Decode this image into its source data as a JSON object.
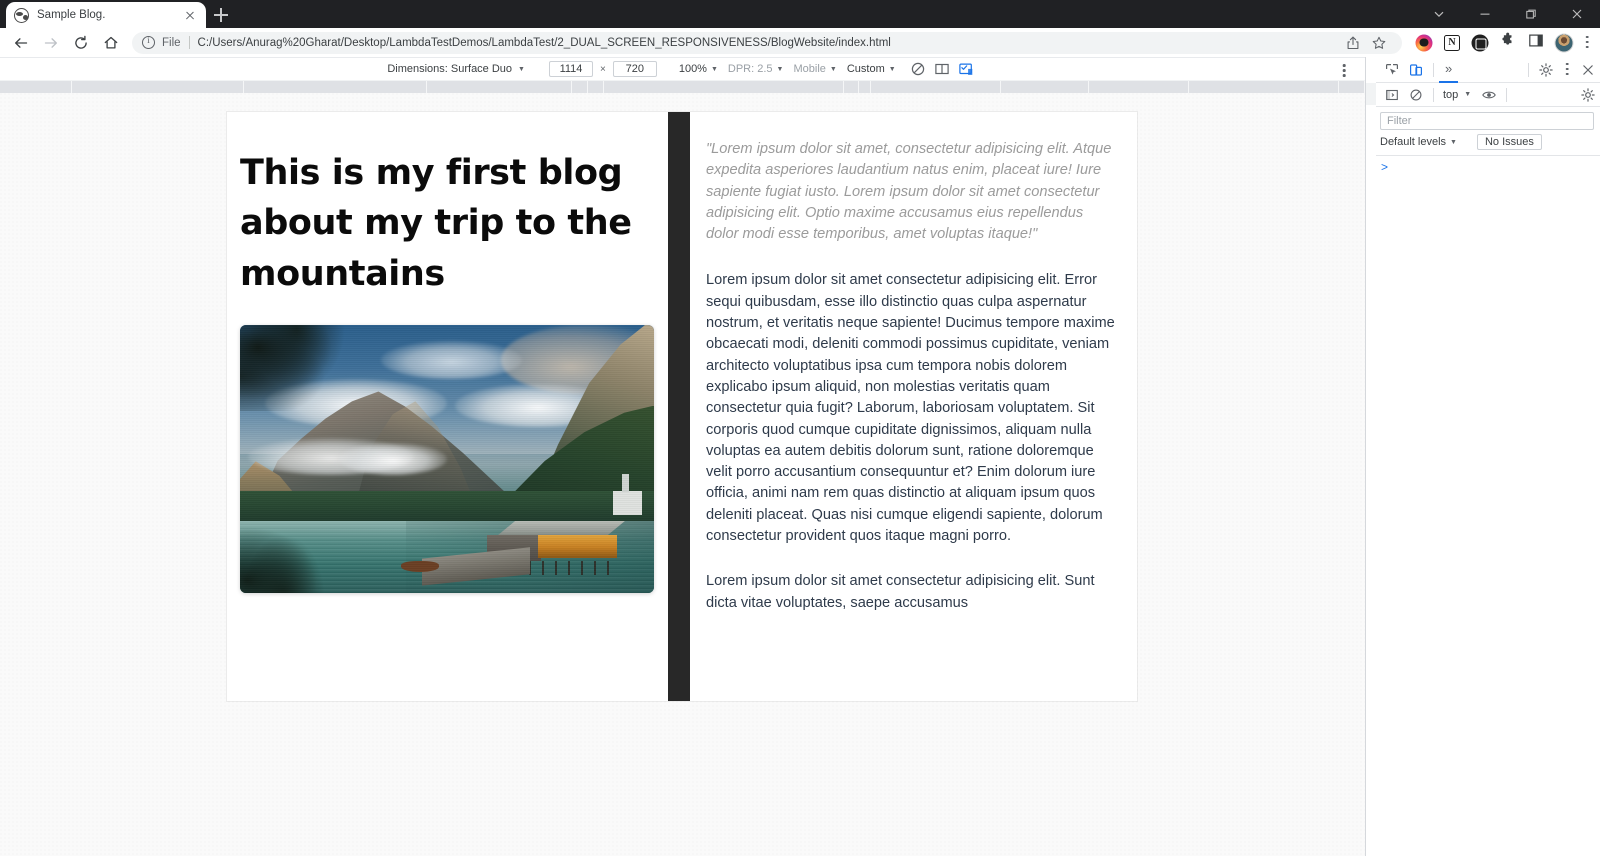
{
  "browser": {
    "tab": {
      "title": "Sample Blog.",
      "favicon": "globe-icon",
      "close": "close-icon"
    },
    "new_tab_label": "+",
    "window_controls": [
      "tab-search-chevron",
      "minimize",
      "restore",
      "close"
    ],
    "nav": {
      "back": "back-arrow",
      "forward": "forward-arrow",
      "reload": "reload-icon",
      "home": "home-icon"
    },
    "omnibox": {
      "info_icon": "info-circle-icon",
      "scheme_label": "File",
      "url": "C:/Users/Anurag%20Gharat/Desktop/LambdaTestDemos/LambdaTest/2_DUAL_SCREEN_RESPONSIVENESS/BlogWebsite/index.html",
      "share_icon": "share-icon",
      "bookmark_icon": "star-icon"
    },
    "extensions": [
      {
        "name": "instagram-extension-icon",
        "glyph": ""
      },
      {
        "name": "notion-extension-icon",
        "glyph": "N"
      },
      {
        "name": "dark-reader-extension-icon",
        "glyph": ""
      },
      {
        "name": "extensions-puzzle-icon",
        "glyph": ""
      },
      {
        "name": "side-panel-icon",
        "glyph": ""
      },
      {
        "name": "profile-avatar",
        "glyph": ""
      }
    ],
    "menu_icon": "kebab-menu-icon"
  },
  "device_toolbar": {
    "dimensions_label": "Dimensions: Surface Duo",
    "width": "1114",
    "separator": "×",
    "height": "720",
    "zoom": "100%",
    "dpr": "DPR: 2.5",
    "user_agent": "Mobile",
    "ua_custom": "Custom",
    "throttle_icon": "no-throttling-icon",
    "dual_screen_icon": "dual-screen-icon",
    "span_icon": "screen-span-icon",
    "kebab": "kebab-menu-icon"
  },
  "ruler": {
    "segments": [
      72,
      172,
      183,
      145,
      16,
      16,
      240,
      15,
      12,
      130,
      88,
      100,
      150,
      26
    ]
  },
  "page": {
    "title": "This is my first blog about my trip to the mountains",
    "image_alt": "mountain-lake-boathouse-photo",
    "blockquote": "\"Lorem ipsum dolor sit amet, consectetur adipisicing elit. Atque expedita asperiores laudantium natus enim, placeat iure! Iure sapiente fugiat iusto. Lorem ipsum dolor sit amet consectetur adipisicing elit. Optio maxime accusamus eius repellendus dolor modi esse temporibus, amet voluptas itaque!\"",
    "paragraphs": [
      "Lorem ipsum dolor sit amet consectetur adipisicing elit. Error sequi quibusdam, esse illo distinctio quas culpa aspernatur nostrum, et veritatis neque sapiente! Ducimus tempore maxime obcaecati modi, deleniti commodi possimus cupiditate, veniam architecto voluptatibus ipsa cum tempora nobis dolorem explicabo ipsum aliquid, non molestias veritatis quam consectetur quia fugit? Laborum, laboriosam voluptatem. Sit corporis quod cumque cupiditate dignissimos, aliquam nulla voluptas ea autem debitis dolorum sunt, ratione doloremque velit porro accusantium consequuntur et? Enim dolorum iure officia, animi nam rem quas distinctio at aliquam ipsum quos deleniti placeat. Quas nisi cumque eligendi sapiente, dolorum consectetur provident quos itaque magni porro.",
      "Lorem ipsum dolor sit amet consectetur adipisicing elit. Sunt dicta vitae voluptates, saepe accusamus"
    ]
  },
  "devtools": {
    "inspect_icon": "inspect-element-icon",
    "device_toggle_icon": "device-toolbar-icon",
    "more_tabs": "»",
    "settings_icon": "gear-icon",
    "kebab_icon": "kebab-menu-icon",
    "close_icon": "close-icon",
    "console": {
      "sidebar_icon": "console-sidebar-icon",
      "clear_icon": "clear-console-icon",
      "context": "top",
      "eye_icon": "live-expression-icon",
      "settings_icon": "gear-icon",
      "filter_placeholder": "Filter",
      "levels_label": "Default levels",
      "issues_label": "No Issues",
      "prompt": ">"
    }
  },
  "colors": {
    "accent": "#1a73e8",
    "chrome_dark": "#202124",
    "seam": "#282828",
    "body_text": "#2e3a4a",
    "quote_text": "#9b9b9b",
    "stage_bg": "#fafafa"
  }
}
